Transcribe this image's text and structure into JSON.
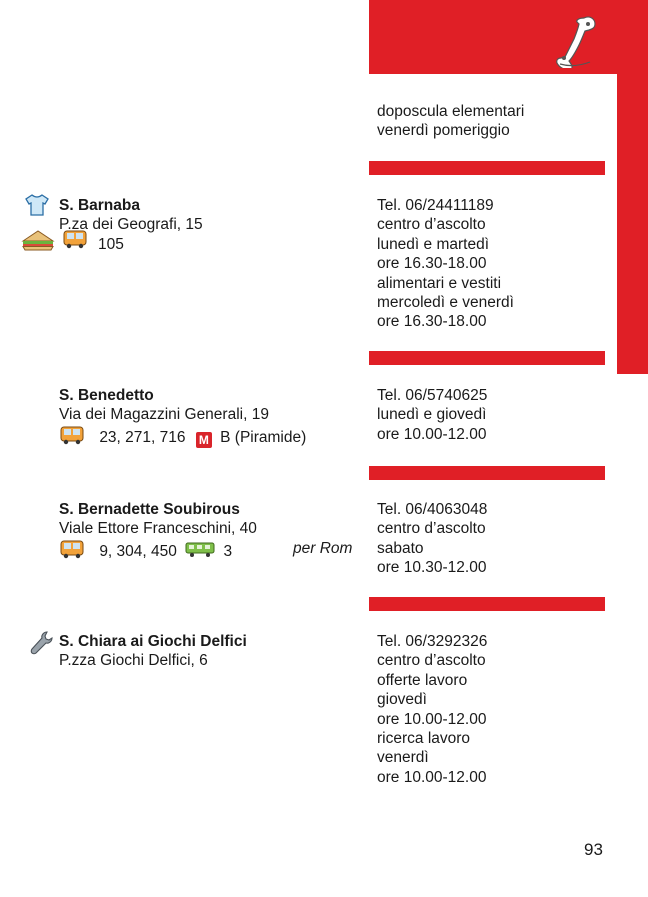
{
  "theme": {
    "accent": "#e01f26"
  },
  "top_block": {
    "icon": "phone-icon",
    "right_lines": [
      "doposcula elementari",
      "venerdì pomeriggio"
    ]
  },
  "entries": [
    {
      "name": "S. Barnaba",
      "address": "P.za dei Geografi, 15",
      "icons": [
        "shirt-icon",
        "sandwich-icon",
        "bus-icon"
      ],
      "bus": "105",
      "right_lines": [
        "Tel. 06/24411189",
        "centro d’ascolto",
        "lunedì e martedì",
        "ore 16.30-18.00",
        "alimentari e vestiti",
        "mercoledì e venerdì",
        "ore 16.30-18.00"
      ]
    },
    {
      "name": "S. Benedetto",
      "address": "Via dei Magazzini Generali, 19",
      "icons": [
        "bus-icon",
        "metro-icon"
      ],
      "bus": "23, 271, 716",
      "metro_letter": "M",
      "metro": "B (Piramide)",
      "right_lines": [
        "Tel. 06/5740625",
        "lunedì e giovedì",
        "ore 10.00-12.00"
      ]
    },
    {
      "name": "S. Bernadette Soubirous",
      "address": "Viale Ettore Franceschini, 40",
      "icons": [
        "bus-icon",
        "tram-icon"
      ],
      "bus": "9, 304, 450",
      "tram": "3",
      "note": "per Rom",
      "right_lines": [
        "Tel. 06/4063048",
        "centro d’ascolto",
        "sabato",
        "ore 10.30-12.00"
      ]
    },
    {
      "name": "S. Chiara ai Giochi Delfici",
      "address": "P.zza Giochi Delfici, 6",
      "icons": [
        "wrench-icon"
      ],
      "right_lines": [
        "Tel. 06/3292326",
        "centro d’ascolto",
        "offerte lavoro",
        "giovedì",
        "ore 10.00-12.00",
        "ricerca lavoro",
        "venerdì",
        "ore 10.00-12.00"
      ]
    }
  ],
  "page_number": "93"
}
